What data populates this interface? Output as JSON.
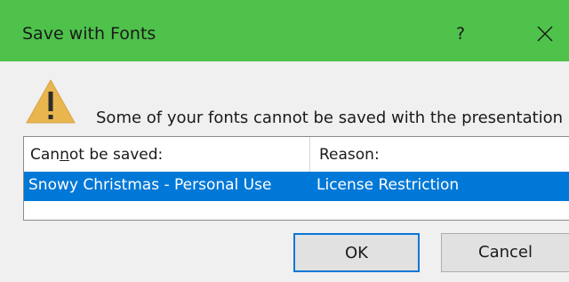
{
  "dialog": {
    "title": "Save with Fonts",
    "help_label": "?",
    "message": "Some of your fonts cannot be saved with the presentation"
  },
  "list": {
    "columns": [
      {
        "label_prefix": "Can",
        "label_underlined": "n",
        "label_suffix": "ot be saved:"
      },
      {
        "label": "Reason:"
      }
    ],
    "rows": [
      {
        "font": "Snowy Christmas - Personal Use",
        "reason": "License Restriction",
        "selected": true
      }
    ]
  },
  "buttons": {
    "ok_label": "OK",
    "cancel_label": "Cancel"
  },
  "icons": {
    "warning": "warning-icon",
    "help": "help-icon",
    "close": "close-icon"
  },
  "colors": {
    "titlebar": "#4ec24b",
    "selection": "#0078d7",
    "warning_fill": "#e8b54f"
  }
}
